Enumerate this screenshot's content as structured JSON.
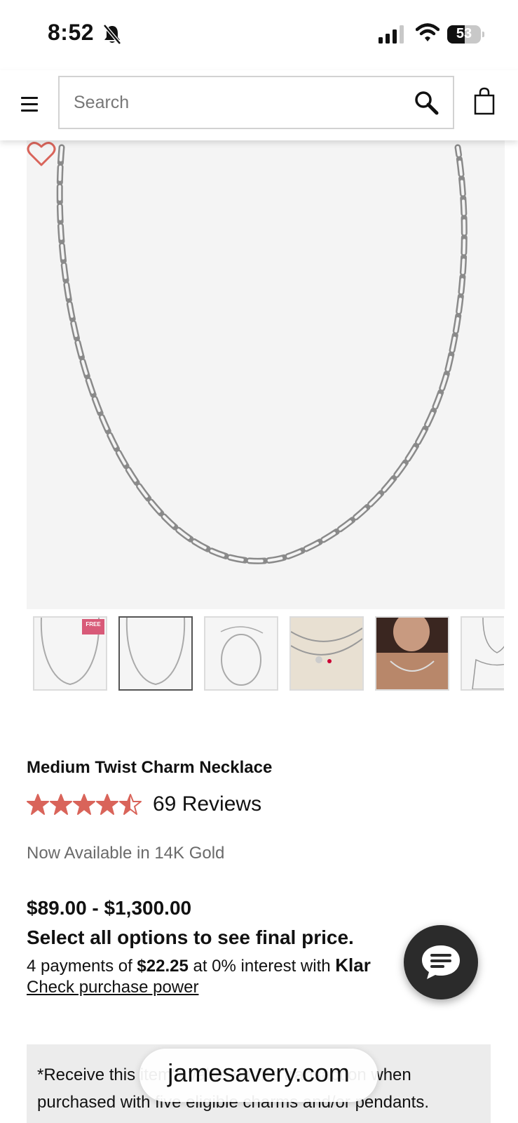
{
  "status_bar": {
    "time": "8:52",
    "battery": "53",
    "battery_fraction": 0.53,
    "icons": [
      "bell-slash-icon",
      "cellular-signal-icon",
      "wifi-icon",
      "battery-icon"
    ]
  },
  "header": {
    "search_placeholder": "Search",
    "icons": [
      "hamburger-menu-icon",
      "search-icon",
      "shopping-bag-icon"
    ]
  },
  "product": {
    "title": "Medium Twist Charm Necklace",
    "rating": 4.5,
    "reviews": "69 Reviews",
    "availability": "Now Available in 14K Gold",
    "price_range": "$89.00 - $1,300.00",
    "price_note": "Select all options to see final price.",
    "klarna": {
      "prefix": "4 payments of ",
      "amount": "$22.25",
      "middle": " at 0% interest with ",
      "brand": "Klar"
    },
    "check_power": "Check purchase power",
    "thumbnails": [
      "Necklace front view with free badge",
      "Necklace front view",
      "Necklace laid flat",
      "Necklace with charms",
      "Model wearing necklace",
      "Length guide"
    ],
    "free_badge": "FREE"
  },
  "promo": {
    "text": "*Receive this item's value off the transaction when purchased with five eligible charms and/or pendants."
  },
  "browser": {
    "url": "jamesavery.com"
  },
  "colors": {
    "accent": "#d9645a",
    "star": "#d9645a",
    "chat_bg": "#2b2b2b",
    "promo_bg": "#ececec"
  }
}
